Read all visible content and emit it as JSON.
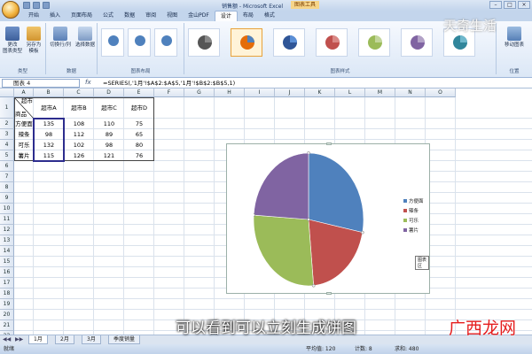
{
  "window": {
    "app_title": "销售额 - Microsoft Excel",
    "tools_title": "图表工具"
  },
  "watermarks": {
    "top": "天奇生活",
    "bottom": "广西龙网"
  },
  "tabs": [
    {
      "label": "开始"
    },
    {
      "label": "插入"
    },
    {
      "label": "页面布局"
    },
    {
      "label": "公式"
    },
    {
      "label": "数据"
    },
    {
      "label": "审阅"
    },
    {
      "label": "视图"
    },
    {
      "label": "金山PDF"
    },
    {
      "label": "设计"
    },
    {
      "label": "布局"
    },
    {
      "label": "格式"
    }
  ],
  "ribbon": {
    "type_group": {
      "label": "类型",
      "change_type": "更改\n图表类型",
      "save_template": "另存为\n模板"
    },
    "data_group": {
      "label": "数据",
      "switch_rowcol": "切换行/列",
      "select_data": "选择数据"
    },
    "layout_group": {
      "label": "图表布局"
    },
    "style_group": {
      "label": "图表样式"
    },
    "location_group": {
      "label": "位置",
      "move_chart": "移动图表"
    }
  },
  "formula_bar": {
    "name_box": "图表 4",
    "fx": "fx",
    "formula": "=SERIES(,'1月'!$A$2:$A$5,'1月'!$B$2:$B$5,1)"
  },
  "columns": [
    "A",
    "B",
    "C",
    "D",
    "E",
    "F",
    "G",
    "H",
    "I",
    "J",
    "K",
    "L",
    "M",
    "N",
    "O"
  ],
  "rows": [
    "1",
    "2",
    "3",
    "4",
    "5",
    "6",
    "7",
    "8",
    "9",
    "10",
    "11",
    "12",
    "13",
    "14",
    "15",
    "16",
    "17",
    "18",
    "19",
    "20",
    "21",
    "22",
    "23"
  ],
  "table": {
    "corner_top": "超市",
    "corner_bottom": "商品",
    "headers": [
      "超市A",
      "超市B",
      "超市C",
      "超市D"
    ],
    "rows": [
      {
        "name": "方便面",
        "values": [
          "135",
          "108",
          "110",
          "75"
        ]
      },
      {
        "name": "辣条",
        "values": [
          "98",
          "112",
          "89",
          "65"
        ]
      },
      {
        "name": "可乐",
        "values": [
          "132",
          "102",
          "98",
          "80"
        ]
      },
      {
        "name": "薯片",
        "values": [
          "115",
          "126",
          "121",
          "76"
        ]
      }
    ]
  },
  "chart_data": {
    "type": "pie",
    "categories": [
      "方便面",
      "辣条",
      "可乐",
      "薯片"
    ],
    "values": [
      135,
      98,
      132,
      115
    ],
    "colors": [
      "#4f81bd",
      "#c0504d",
      "#9bbb59",
      "#8064a2"
    ],
    "legend": "right"
  },
  "tooltip": "图表区",
  "sheet_tabs": [
    "1月",
    "2月",
    "3月",
    "季度销量"
  ],
  "status": {
    "left": "就绪",
    "average": "平均值: 120",
    "count": "计数: 8",
    "sum": "求和: 480"
  },
  "subtitle": "可以看到可以立刻生成饼图",
  "colors": {
    "accent": "#2d2d8e",
    "ribbon": "#dbe7f6"
  }
}
